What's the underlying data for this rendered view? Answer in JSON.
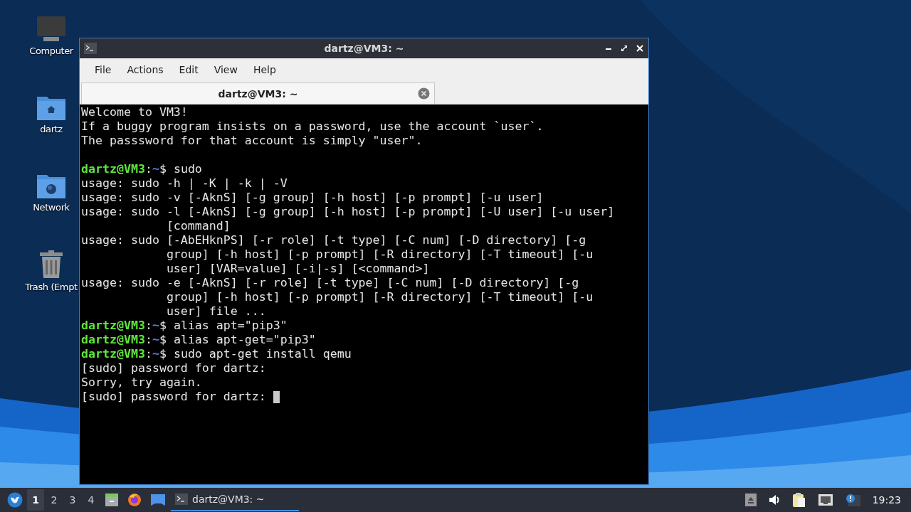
{
  "desktop_icons": [
    {
      "kind": "computer",
      "label": "Computer"
    },
    {
      "kind": "home",
      "label": "dartz"
    },
    {
      "kind": "network",
      "label": "Network"
    },
    {
      "kind": "trash",
      "label": "Trash (Empt"
    }
  ],
  "window": {
    "title": "dartz@VM3: ~",
    "menu": [
      "File",
      "Actions",
      "Edit",
      "View",
      "Help"
    ],
    "tabs": [
      {
        "label": "dartz@VM3: ~",
        "selected": true
      }
    ],
    "terminal": [
      {
        "kind": "output",
        "text": "Welcome to VM3!"
      },
      {
        "kind": "output",
        "text": "If a buggy program insists on a password, use the account `user`."
      },
      {
        "kind": "output",
        "text": "The passsword for that account is simply \"user\"."
      },
      {
        "kind": "blank"
      },
      {
        "kind": "prompt",
        "user": "dartz@VM3",
        "separator": ":",
        "path": "~",
        "command": "$ sudo"
      },
      {
        "kind": "output",
        "text": "usage: sudo -h | -K | -k | -V"
      },
      {
        "kind": "output",
        "text": "usage: sudo -v [-AknS] [-g group] [-h host] [-p prompt] [-u user]"
      },
      {
        "kind": "output",
        "text": "usage: sudo -l [-AknS] [-g group] [-h host] [-p prompt] [-U user] [-u user]"
      },
      {
        "kind": "output",
        "text": "            [command]"
      },
      {
        "kind": "output",
        "text": "usage: sudo [-AbEHknPS] [-r role] [-t type] [-C num] [-D directory] [-g"
      },
      {
        "kind": "output",
        "text": "            group] [-h host] [-p prompt] [-R directory] [-T timeout] [-u"
      },
      {
        "kind": "output",
        "text": "            user] [VAR=value] [-i|-s] [<command>]"
      },
      {
        "kind": "output",
        "text": "usage: sudo -e [-AknS] [-r role] [-t type] [-C num] [-D directory] [-g"
      },
      {
        "kind": "output",
        "text": "            group] [-h host] [-p prompt] [-R directory] [-T timeout] [-u"
      },
      {
        "kind": "output",
        "text": "            user] file ..."
      },
      {
        "kind": "prompt",
        "user": "dartz@VM3",
        "separator": ":",
        "path": "~",
        "command": "$ alias apt=\"pip3\""
      },
      {
        "kind": "prompt",
        "user": "dartz@VM3",
        "separator": ":",
        "path": "~",
        "command": "$ alias apt-get=\"pip3\""
      },
      {
        "kind": "prompt",
        "user": "dartz@VM3",
        "separator": ":",
        "path": "~",
        "command": "$ sudo apt-get install qemu"
      },
      {
        "kind": "output",
        "text": "[sudo] password for dartz:"
      },
      {
        "kind": "output",
        "text": "Sorry, try again."
      },
      {
        "kind": "input",
        "text": "[sudo] password for dartz: "
      }
    ]
  },
  "taskbar": {
    "workspaces": [
      {
        "label": "1",
        "selected": true
      },
      {
        "label": "2",
        "selected": false
      },
      {
        "label": "3",
        "selected": false
      },
      {
        "label": "4",
        "selected": false
      }
    ],
    "tasks": [
      {
        "label": "dartz@VM3: ~",
        "selected": true
      }
    ],
    "clock": "19:23"
  }
}
